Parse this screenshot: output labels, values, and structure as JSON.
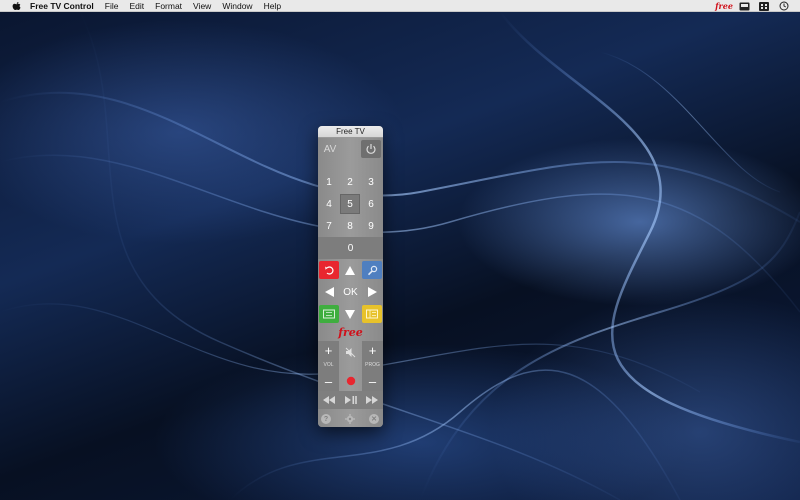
{
  "menubar": {
    "app_name": "Free TV Control",
    "items": [
      "File",
      "Edit",
      "Format",
      "View",
      "Window",
      "Help"
    ],
    "status_icons": [
      "free-logo-icon",
      "tv-box-icon",
      "grid-icon",
      "time-machine-icon"
    ],
    "free_label": "free"
  },
  "window": {
    "title": "Free TV"
  },
  "remote": {
    "av_label": "AV",
    "numbers": [
      "1",
      "2",
      "3",
      "4",
      "5",
      "6",
      "7",
      "8",
      "9",
      "0"
    ],
    "selected_number": "5",
    "ok_label": "OK",
    "brand": "free",
    "vol_label": "VOL",
    "prog_label": "PROG",
    "plus": "+",
    "minus": "–",
    "colors": {
      "red": "#e8262f",
      "blue": "#4f7fc0",
      "green": "#3fae3f",
      "yellow": "#e7c22b",
      "record": "#e8262f"
    }
  }
}
